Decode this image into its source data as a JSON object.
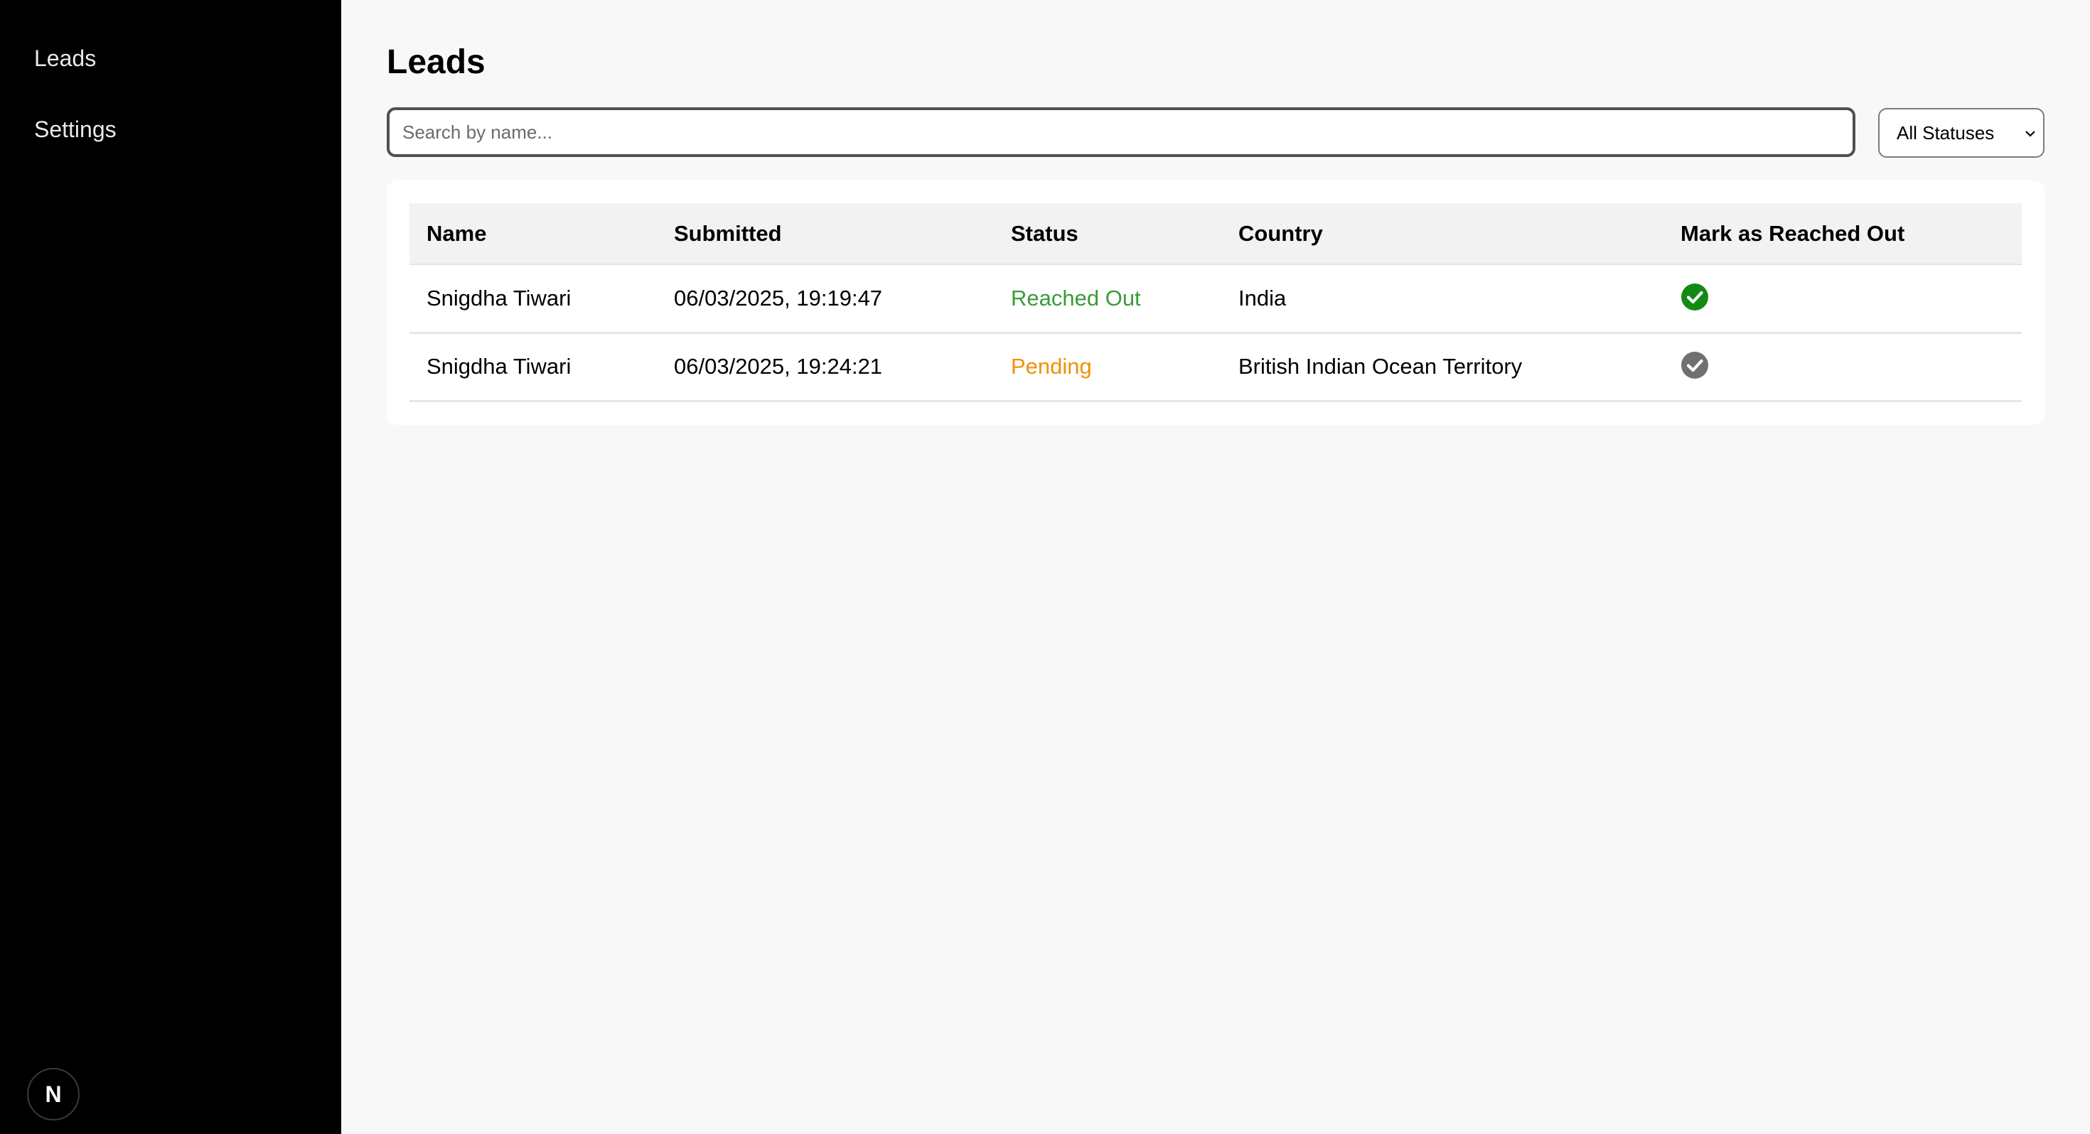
{
  "sidebar": {
    "items": [
      {
        "label": "Leads"
      },
      {
        "label": "Settings"
      }
    ],
    "logo_text": "N"
  },
  "page": {
    "title": "Leads"
  },
  "search": {
    "placeholder": "Search by name...",
    "value": ""
  },
  "filter": {
    "selected": "All Statuses"
  },
  "table": {
    "columns": [
      "Name",
      "Submitted",
      "Status",
      "Country",
      "Mark as Reached Out"
    ],
    "rows": [
      {
        "name": "Snigdha Tiwari",
        "submitted": "06/03/2025, 19:19:47",
        "status": "Reached Out",
        "country": "India",
        "reached": true
      },
      {
        "name": "Snigdha Tiwari",
        "submitted": "06/03/2025, 19:24:21",
        "status": "Pending",
        "country": "British Indian Ocean Territory",
        "reached": false
      }
    ]
  },
  "colors": {
    "reached_status": "#3a9a3a",
    "pending_status": "#f0900a",
    "check_done": "#138a13",
    "check_pending": "#707070"
  },
  "icons": {
    "check_done": "check-circle-filled-icon",
    "check_pending": "check-circle-icon",
    "select_chevron": "chevron-down-icon"
  }
}
